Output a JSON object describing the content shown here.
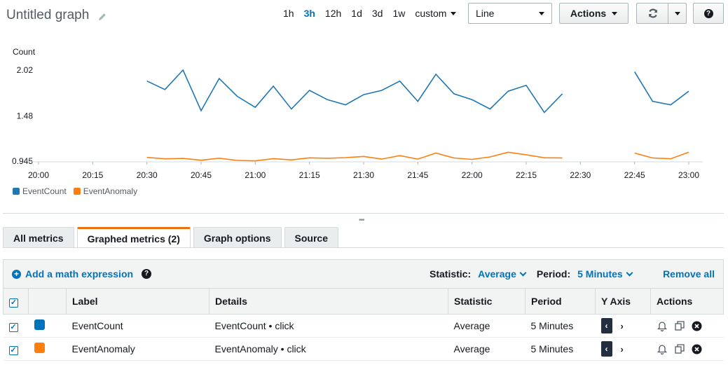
{
  "header": {
    "title": "Untitled graph",
    "ranges": [
      "1h",
      "3h",
      "12h",
      "1d",
      "3d",
      "1w"
    ],
    "active_range": "3h",
    "custom_label": "custom",
    "view_select": "Line",
    "actions_label": "Actions"
  },
  "chart_data": {
    "type": "line",
    "ylabel": "Count",
    "yticks": [
      "2.02",
      "1.48",
      "0.945"
    ],
    "ylim": [
      0.945,
      2.02
    ],
    "xticks": [
      "20:00",
      "20:15",
      "20:30",
      "20:45",
      "21:00",
      "21:15",
      "21:30",
      "21:45",
      "22:00",
      "22:15",
      "22:30",
      "22:45",
      "23:00"
    ],
    "grid": false,
    "legend_placement": "bottom-left",
    "series": [
      {
        "name": "EventCount",
        "color": "#1f77b4",
        "x": [
          "20:30",
          "20:35",
          "20:40",
          "20:45",
          "20:50",
          "20:55",
          "21:00",
          "21:05",
          "21:10",
          "21:15",
          "21:20",
          "21:25",
          "21:30",
          "21:35",
          "21:40",
          "21:45",
          "21:50",
          "21:55",
          "22:00",
          "22:05",
          "22:10",
          "22:15",
          "22:20",
          "22:25",
          "22:30",
          "22:35",
          "22:40",
          "22:45",
          "22:50",
          "22:55",
          "23:00"
        ],
        "values": [
          1.89,
          1.79,
          2.02,
          1.54,
          1.92,
          1.71,
          1.58,
          1.83,
          1.56,
          1.78,
          1.67,
          1.61,
          1.73,
          1.78,
          1.89,
          1.65,
          1.97,
          1.74,
          1.67,
          1.56,
          1.77,
          1.84,
          1.52,
          1.74,
          null,
          null,
          null,
          2.0,
          1.65,
          1.61,
          1.77
        ]
      },
      {
        "name": "EventAnomaly",
        "color": "#ff7f0e",
        "x": [
          "20:30",
          "20:35",
          "20:40",
          "20:45",
          "20:50",
          "20:55",
          "21:00",
          "21:05",
          "21:10",
          "21:15",
          "21:20",
          "21:25",
          "21:30",
          "21:35",
          "21:40",
          "21:45",
          "21:50",
          "21:55",
          "22:00",
          "22:05",
          "22:10",
          "22:15",
          "22:20",
          "22:25",
          "22:30",
          "22:35",
          "22:40",
          "22:45",
          "22:50",
          "22:55",
          "23:00"
        ],
        "values": [
          0.989,
          0.972,
          0.977,
          0.956,
          0.98,
          0.953,
          0.948,
          0.975,
          0.96,
          0.984,
          0.979,
          0.986,
          1.0,
          0.969,
          1.01,
          0.969,
          1.04,
          0.982,
          0.966,
          0.995,
          1.05,
          1.02,
          0.985,
          0.983,
          null,
          null,
          null,
          1.04,
          0.982,
          0.973,
          1.05
        ]
      }
    ]
  },
  "tabs": [
    {
      "label": "All metrics",
      "active": false
    },
    {
      "label": "Graphed metrics (2)",
      "active": true
    },
    {
      "label": "Graph options",
      "active": false
    },
    {
      "label": "Source",
      "active": false
    }
  ],
  "toolbar": {
    "add_math": "Add a math expression",
    "statistic_label": "Statistic:",
    "statistic_value": "Average",
    "period_label": "Period:",
    "period_value": "5 Minutes",
    "remove_all": "Remove all"
  },
  "table": {
    "headers": [
      "Label",
      "Details",
      "Statistic",
      "Period",
      "Y Axis",
      "Actions"
    ],
    "rows": [
      {
        "label": "EventCount",
        "details": "EventCount • click",
        "statistic": "Average",
        "period": "5 Minutes",
        "color": "#0073bb"
      },
      {
        "label": "EventAnomaly",
        "details": "EventAnomaly • click",
        "statistic": "Average",
        "period": "5 Minutes",
        "color": "#ff7f0e"
      }
    ]
  }
}
